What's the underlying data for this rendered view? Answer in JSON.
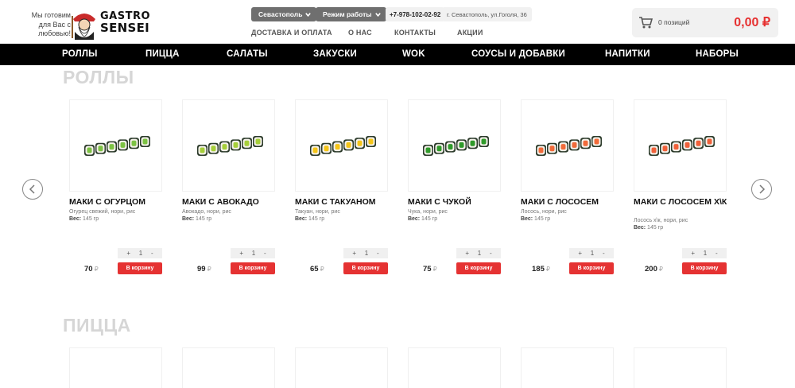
{
  "header": {
    "tagline": "Мы готовим для Вас с любовью!",
    "logo_line1": "GASTRO",
    "logo_line2": "SENSEI",
    "city_button": "Севастополь",
    "hours_button": "Режим работы",
    "phone": "+7-978-102-02-92",
    "address": "г. Севастополь, ул.Гоголя, 36",
    "links": [
      "ДОСТАВКА И ОПЛАТА",
      "О НАС",
      "КОНТАКТЫ",
      "АКЦИИ"
    ],
    "cart_count": "0 позиций",
    "cart_total": "0,00 ₽"
  },
  "nav": [
    "РОЛЛЫ",
    "ПИЦЦА",
    "САЛАТЫ",
    "ЗАКУСКИ",
    "WOK",
    "СОУСЫ И ДОБАВКИ",
    "НАПИТКИ",
    "НАБОРЫ"
  ],
  "sections": {
    "rolls_title": "РОЛЛЫ",
    "pizza_title": "ПИЦЦА"
  },
  "weight_label": "Вес:",
  "currency": "₽",
  "buy_label": "В корзину",
  "stepper": {
    "minus": "+",
    "qty": "1",
    "plus": "-"
  },
  "products": [
    {
      "name": "МАКИ С ОГУРЦОМ",
      "desc": "Огурец свежий, нори, рис",
      "weight": "145 гр",
      "price": "70",
      "filling": "#7cc243"
    },
    {
      "name": "МАКИ С АВОКАДО",
      "desc": "Авокадо, нори, рис",
      "weight": "145 гр",
      "price": "99",
      "filling": "#a6cf3a"
    },
    {
      "name": "МАКИ С ТАКУАНОМ",
      "desc": "Такуан, нори, рис",
      "weight": "145 гр",
      "price": "65",
      "filling": "#f5c518"
    },
    {
      "name": "МАКИ С ЧУКОЙ",
      "desc": "Чука, нори, рис",
      "weight": "145 гр",
      "price": "75",
      "filling": "#2f9a2a"
    },
    {
      "name": "МАКИ С ЛОСОСЕМ",
      "desc": "Лосось, нори, рис",
      "weight": "145 гр",
      "price": "185",
      "filling": "#f26b3a"
    },
    {
      "name": "МАКИ С ЛОСОСЕМ Х\\К",
      "desc": "Лосось х\\к, нори, рис",
      "weight": "145 гр",
      "price": "200",
      "filling": "#f0613a"
    }
  ],
  "colors": {
    "accent": "#e53232",
    "nav_bg": "#000000"
  }
}
